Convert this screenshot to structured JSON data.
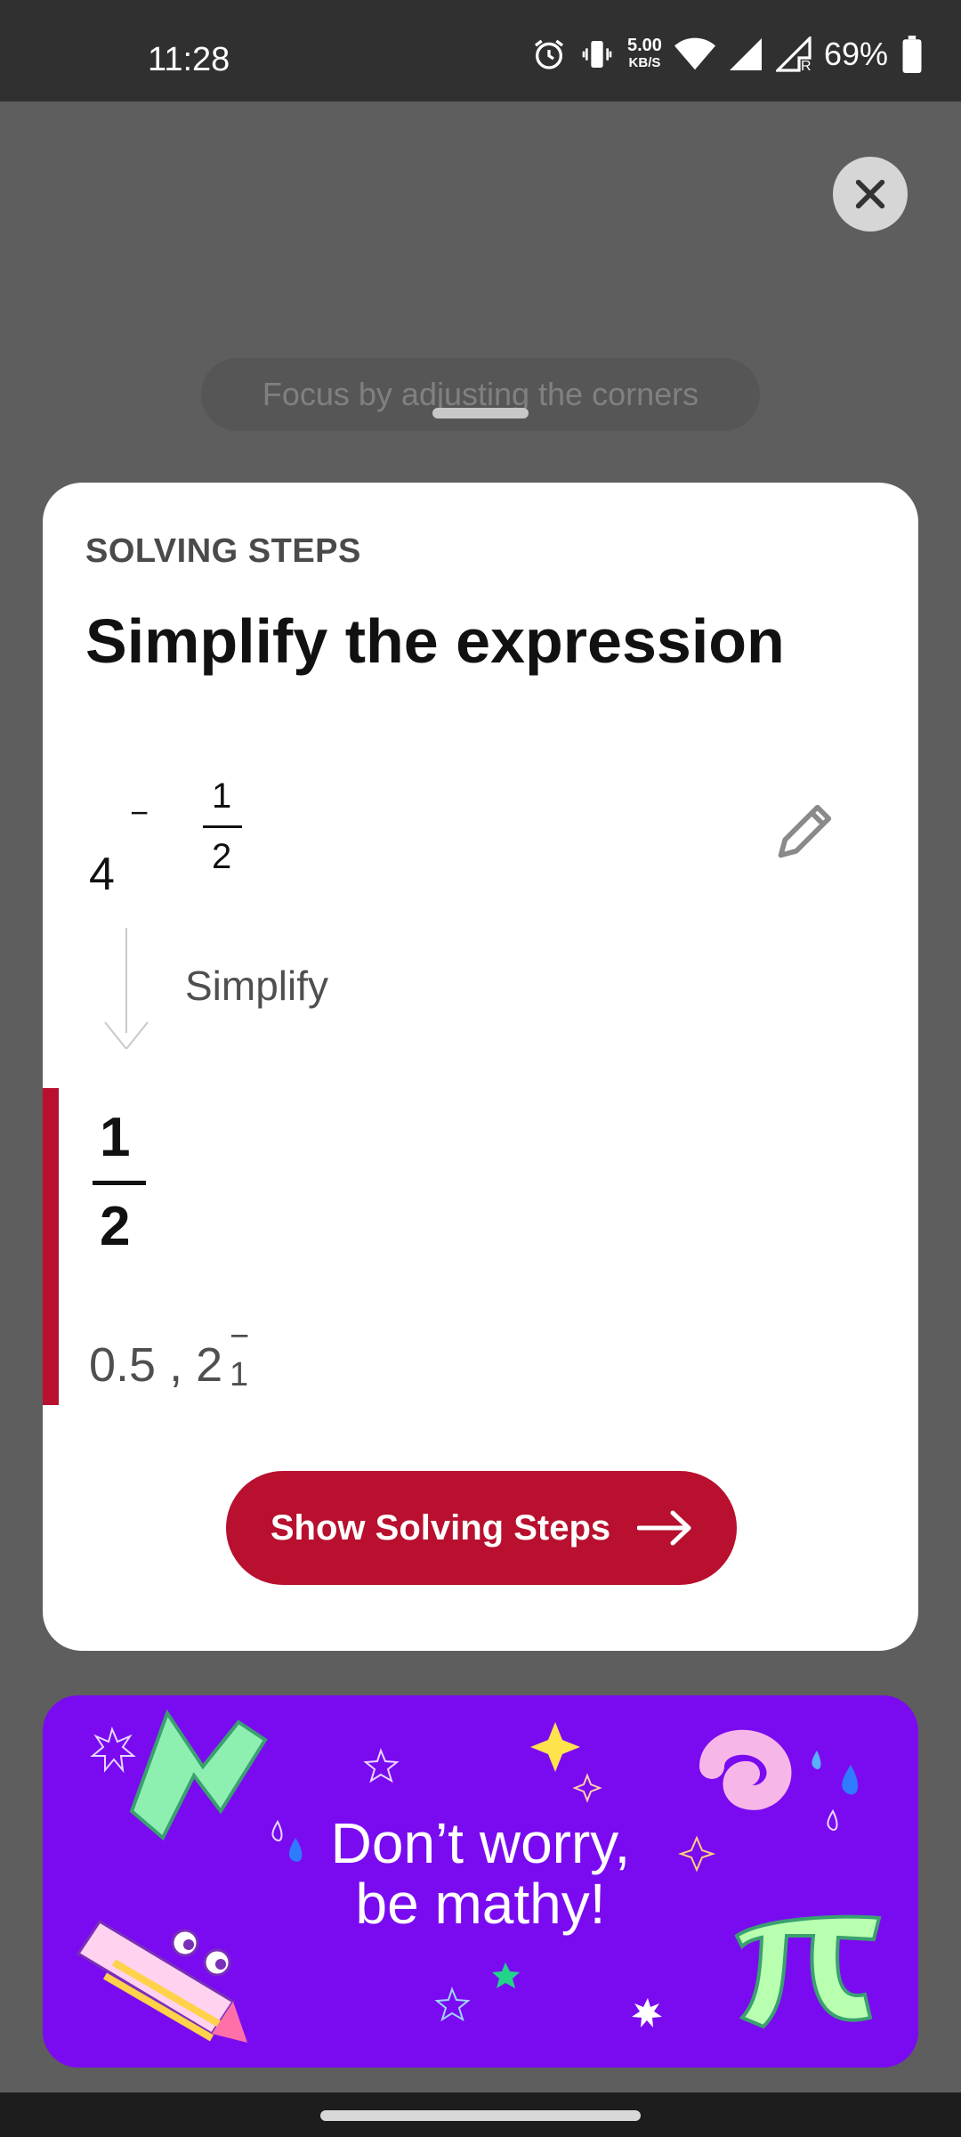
{
  "status_bar": {
    "time": "11:28",
    "net_speed_value": "5.00",
    "net_speed_unit": "KB/S",
    "battery": "69%",
    "icons": [
      "alarm-icon",
      "vibrate-icon",
      "wifi-icon",
      "signal-icon",
      "signal-roaming-icon",
      "battery-icon"
    ]
  },
  "overlay": {
    "focus_hint": "Focus by adjusting the corners",
    "close_icon": "close-icon"
  },
  "card": {
    "kicker": "SOLVING STEPS",
    "title": "Simplify the expression",
    "expression": {
      "base": "4",
      "exponent_sign": "−",
      "exponent_numerator": "1",
      "exponent_denominator": "2"
    },
    "edit_icon": "pencil-icon",
    "step_label": "Simplify",
    "result": {
      "numerator": "1",
      "denominator": "2"
    },
    "alternate_forms": {
      "text": "0.5 , 2",
      "superscript": "− 1"
    },
    "cta_label": "Show Solving Steps",
    "cta_icon": "arrow-right-icon"
  },
  "promo": {
    "headline_line1": "Don’t worry,",
    "headline_line2": "be mathy!"
  },
  "colors": {
    "accent": "#b8102e",
    "promo_bg": "#7a0bf0",
    "overlay_bg": "#5e5e5e"
  }
}
